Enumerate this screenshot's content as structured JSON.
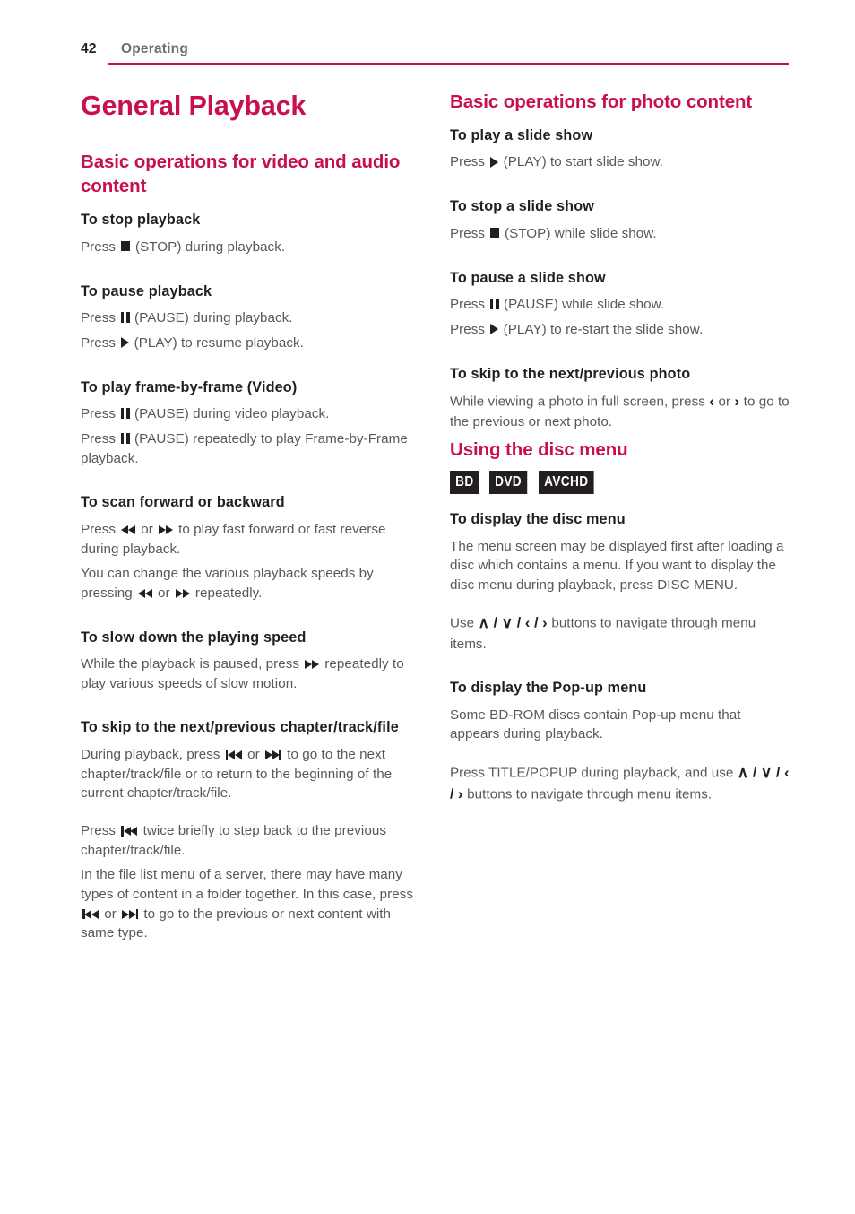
{
  "header": {
    "page_number": "42",
    "section": "Operating",
    "rule_color": "#c8104e"
  },
  "colors": {
    "heading": "#c8104e",
    "subheading": "#231f20",
    "body": "#58585a",
    "badge_bg": "#231f20",
    "badge_text": "#ffffff"
  },
  "left_column": {
    "title": "General Playback",
    "section_heading": "Basic operations for video and audio content",
    "blocks": [
      {
        "heading": "To stop playback",
        "paragraphs": [
          [
            {
              "t": "text",
              "v": "Press "
            },
            {
              "t": "icon",
              "v": "stop-icon"
            },
            {
              "t": "text",
              "v": " (STOP) during playback."
            }
          ]
        ]
      },
      {
        "heading": "To pause playback",
        "paragraphs": [
          [
            {
              "t": "text",
              "v": "Press "
            },
            {
              "t": "icon",
              "v": "pause-icon"
            },
            {
              "t": "text",
              "v": " (PAUSE) during playback."
            }
          ],
          [
            {
              "t": "text",
              "v": "Press "
            },
            {
              "t": "icon",
              "v": "play-icon"
            },
            {
              "t": "text",
              "v": " (PLAY) to resume playback."
            }
          ]
        ]
      },
      {
        "heading": "To play frame-by-frame (Video)",
        "paragraphs": [
          [
            {
              "t": "text",
              "v": "Press "
            },
            {
              "t": "icon",
              "v": "pause-icon"
            },
            {
              "t": "text",
              "v": " (PAUSE) during video playback."
            }
          ],
          [
            {
              "t": "text",
              "v": "Press "
            },
            {
              "t": "icon",
              "v": "pause-icon"
            },
            {
              "t": "text",
              "v": " (PAUSE) repeatedly to play Frame-by-Frame playback."
            }
          ]
        ]
      },
      {
        "heading": "To scan forward or backward",
        "paragraphs": [
          [
            {
              "t": "text",
              "v": "Press "
            },
            {
              "t": "icon",
              "v": "rewind-icon"
            },
            {
              "t": "text",
              "v": " or "
            },
            {
              "t": "icon",
              "v": "fast-forward-icon"
            },
            {
              "t": "text",
              "v": " to play fast forward or fast reverse during playback."
            }
          ],
          [
            {
              "t": "text",
              "v": "You can change the various playback speeds by pressing "
            },
            {
              "t": "icon",
              "v": "rewind-icon"
            },
            {
              "t": "text",
              "v": " or "
            },
            {
              "t": "icon",
              "v": "fast-forward-icon"
            },
            {
              "t": "text",
              "v": " repeatedly."
            }
          ]
        ]
      },
      {
        "heading": "To slow down the playing speed",
        "paragraphs": [
          [
            {
              "t": "text",
              "v": "While the playback is paused, press "
            },
            {
              "t": "icon",
              "v": "fast-forward-icon"
            },
            {
              "t": "text",
              "v": " repeatedly to play various speeds of slow motion."
            }
          ]
        ]
      },
      {
        "heading": "To skip to the next/previous chapter/track/file",
        "paragraphs": [
          [
            {
              "t": "text",
              "v": "During playback, press "
            },
            {
              "t": "icon",
              "v": "skip-previous-icon"
            },
            {
              "t": "text",
              "v": " or "
            },
            {
              "t": "icon",
              "v": "skip-next-icon"
            },
            {
              "t": "text",
              "v": " to go to the next chapter/track/file or to return to the beginning of the current chapter/track/file."
            }
          ],
          [
            {
              "t": "text",
              "v": "Press "
            },
            {
              "t": "icon",
              "v": "skip-previous-icon"
            },
            {
              "t": "text",
              "v": " twice briefly to step back to the previous chapter/track/file."
            }
          ],
          [
            {
              "t": "text",
              "v": "In the file list menu of a server, there may have many types of content in a folder together. In this case, press "
            },
            {
              "t": "icon",
              "v": "skip-previous-icon"
            },
            {
              "t": "text",
              "v": " or "
            },
            {
              "t": "icon",
              "v": "skip-next-icon"
            },
            {
              "t": "text",
              "v": " to go to the previous or next content with same type."
            }
          ]
        ]
      }
    ]
  },
  "right_column": {
    "section_heading": "Basic operations for photo content",
    "blocks": [
      {
        "heading": "To play a slide show",
        "paragraphs": [
          [
            {
              "t": "text",
              "v": "Press "
            },
            {
              "t": "icon",
              "v": "play-icon"
            },
            {
              "t": "text",
              "v": " (PLAY) to start slide show."
            }
          ]
        ]
      },
      {
        "heading": "To stop a slide show",
        "paragraphs": [
          [
            {
              "t": "text",
              "v": "Press "
            },
            {
              "t": "icon",
              "v": "stop-icon"
            },
            {
              "t": "text",
              "v": " (STOP) while slide show."
            }
          ]
        ]
      },
      {
        "heading": "To pause a slide show",
        "paragraphs": [
          [
            {
              "t": "text",
              "v": "Press "
            },
            {
              "t": "icon",
              "v": "pause-icon"
            },
            {
              "t": "text",
              "v": " (PAUSE) while slide show."
            }
          ],
          [
            {
              "t": "text",
              "v": "Press "
            },
            {
              "t": "icon",
              "v": "play-icon"
            },
            {
              "t": "text",
              "v": " (PLAY) to re-start the slide show."
            }
          ]
        ]
      },
      {
        "heading": "To skip to the next/previous photo",
        "paragraphs": [
          [
            {
              "t": "text",
              "v": "While viewing a photo in full screen, press "
            },
            {
              "t": "glyph",
              "v": "‹"
            },
            {
              "t": "text",
              "v": " or "
            },
            {
              "t": "glyph",
              "v": "›"
            },
            {
              "t": "text",
              "v": " to go to the previous or next photo."
            }
          ]
        ]
      }
    ],
    "disc_menu": {
      "heading": "Using the disc menu",
      "badges": [
        "BD",
        "DVD",
        "AVCHD"
      ],
      "blocks": [
        {
          "heading": "To display the disc menu",
          "paragraphs": [
            [
              {
                "t": "text",
                "v": "The menu screen may be displayed first after loading a disc which contains a menu. If you want to display the disc menu during playback, press DISC MENU."
              }
            ],
            [
              {
                "t": "text",
                "v": "Use "
              },
              {
                "t": "glyph",
                "v": "∧"
              },
              {
                "t": "sep",
                "v": " / "
              },
              {
                "t": "glyph",
                "v": "∨"
              },
              {
                "t": "sep",
                "v": " / "
              },
              {
                "t": "glyph",
                "v": "‹"
              },
              {
                "t": "sep",
                "v": " / "
              },
              {
                "t": "glyph",
                "v": "›"
              },
              {
                "t": "text",
                "v": " buttons to navigate through menu items."
              }
            ]
          ]
        },
        {
          "heading": "To display the Pop-up menu",
          "paragraphs": [
            [
              {
                "t": "text",
                "v": "Some BD-ROM discs contain Pop-up menu that appears during playback."
              }
            ],
            [
              {
                "t": "text",
                "v": "Press TITLE/POPUP during playback, and use "
              },
              {
                "t": "glyph",
                "v": "∧"
              },
              {
                "t": "sep",
                "v": " / "
              },
              {
                "t": "glyph",
                "v": "∨"
              },
              {
                "t": "sep",
                "v": " / "
              },
              {
                "t": "glyph",
                "v": "‹"
              },
              {
                "t": "sep",
                "v": " / "
              },
              {
                "t": "glyph",
                "v": "›"
              },
              {
                "t": "text",
                "v": " buttons to navigate through menu items."
              }
            ]
          ]
        }
      ]
    }
  }
}
